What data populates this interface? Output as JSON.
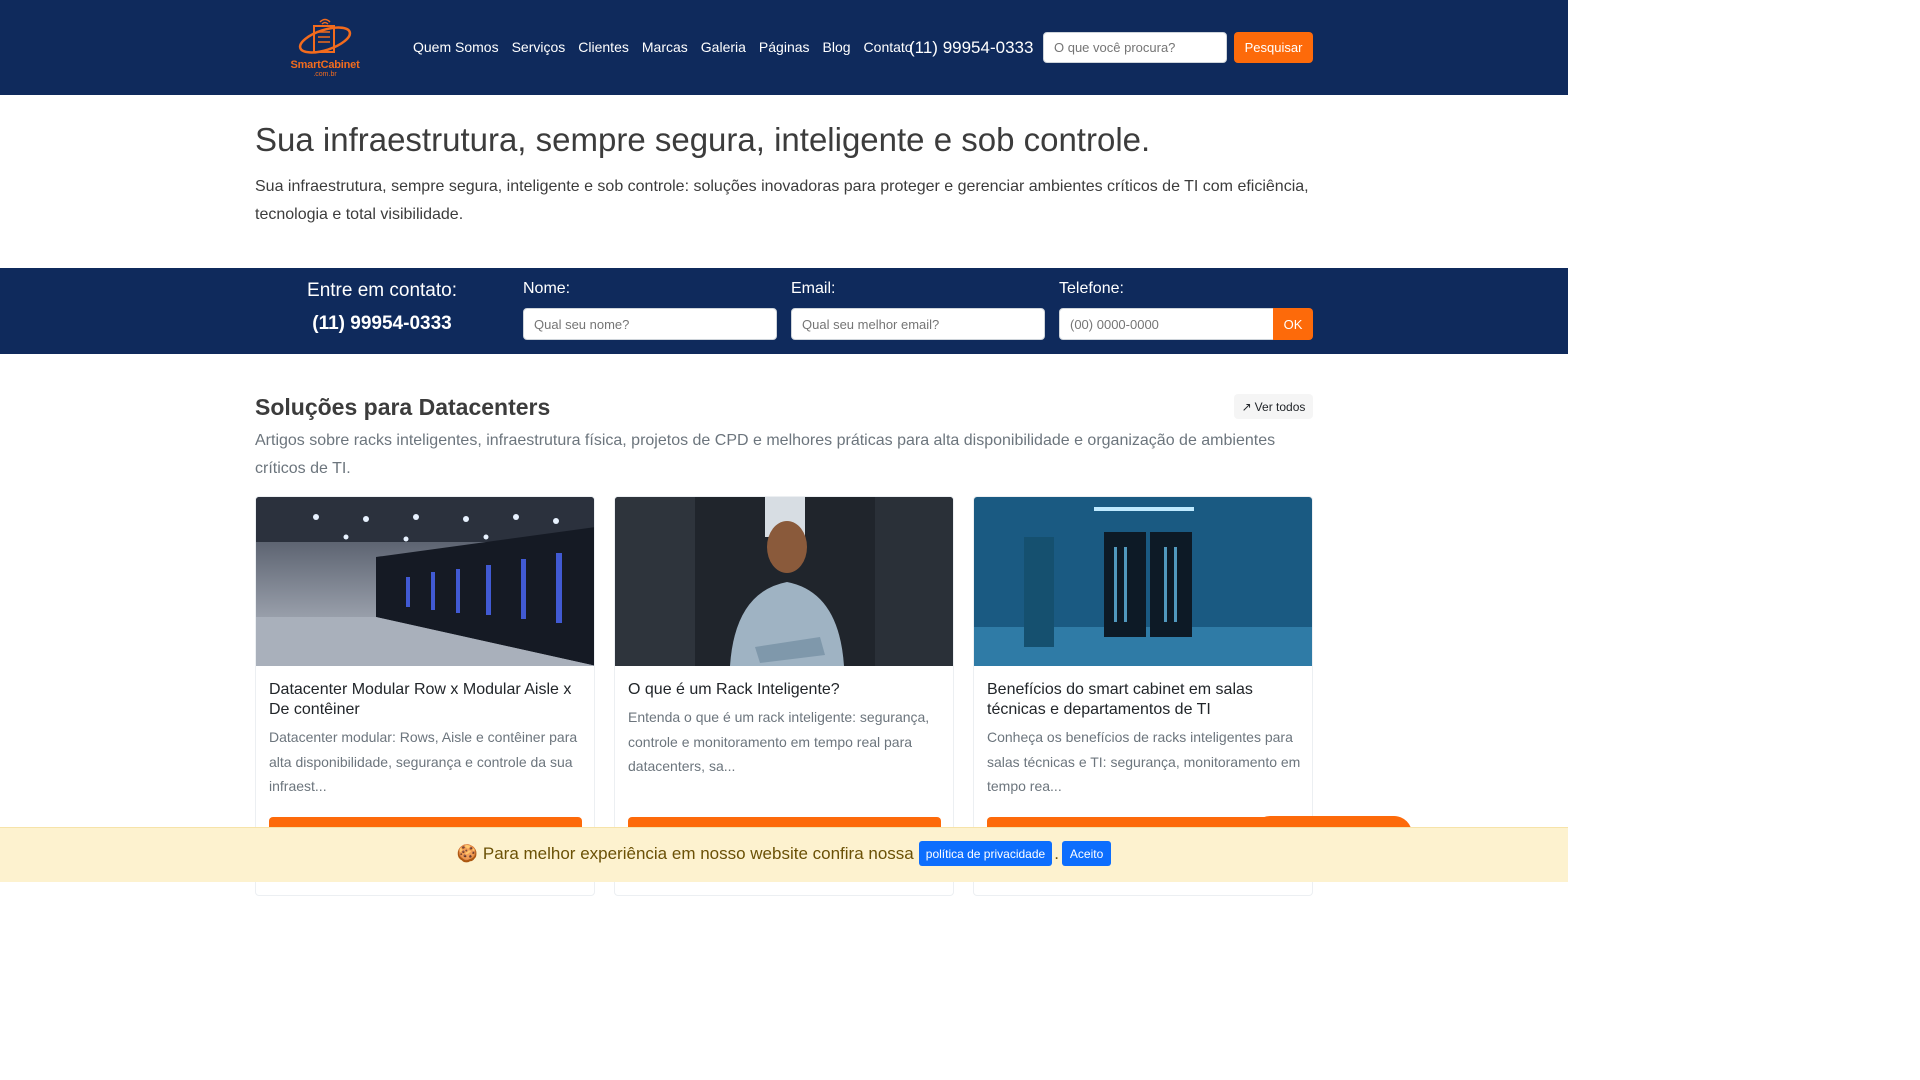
{
  "header": {
    "logo_text": "SmartCabinet",
    "logo_sub": ".com.br",
    "nav": [
      "Quem Somos",
      "Serviços",
      "Clientes",
      "Marcas",
      "Galeria",
      "Páginas",
      "Blog",
      "Contato"
    ],
    "phone": "(11) 99954-0333",
    "search_placeholder": "O que você procura?",
    "search_button": "Pesquisar"
  },
  "hero": {
    "title": "Sua infraestrutura, sempre segura, inteligente e sob controle.",
    "text": "Sua infraestrutura, sempre segura, inteligente e sob controle: soluções inovadoras para proteger e gerenciar ambientes críticos de TI com eficiência, tecnologia e total visibilidade."
  },
  "contact": {
    "label": "Entre em contato:",
    "phone": "(11) 99954-0333",
    "name_label": "Nome:",
    "name_placeholder": "Qual seu nome?",
    "email_label": "Email:",
    "email_placeholder": "Qual seu melhor email?",
    "phone_label": "Telefone:",
    "phone_placeholder": "(00) 0000-0000",
    "ok_button": "OK"
  },
  "section": {
    "title": "Soluções para Datacenters",
    "ver_todos": "Ver todos",
    "ver_todos_icon": "↗",
    "text": "Artigos sobre racks inteligentes, infraestrutura física, projetos de CPD e melhores práticas para alta disponibilidade e organização de ambientes críticos de TI."
  },
  "cards": [
    {
      "title": "Datacenter Modular Row x Modular Aisle x De contêiner",
      "text": "Datacenter modular: Rows, Aisle e contêiner para alta disponibilidade, segurança e controle da sua infraest..."
    },
    {
      "title": "O que é um Rack Inteligente?",
      "text": "Entenda o que é um rack inteligente: segurança, controle e monitoramento em tempo real para datacenters, sa..."
    },
    {
      "title": "Benefícios do smart cabinet em salas técnicas e departamentos de TI",
      "text": "Conheça os benefícios de racks inteligentes para salas técnicas e TI: segurança, monitoramento em tempo rea..."
    }
  ],
  "cookie": {
    "emoji": "🍪",
    "text": "Para melhor experiência em nosso website confira nossa",
    "policy_button": "política de privacidade",
    "dot": ".",
    "accept_button": "Aceito"
  },
  "colors": {
    "navy": "#0f2a5c",
    "orange": "#fd6a0a",
    "blue": "#0d6efd",
    "cookie_bg": "#fdf2cf"
  }
}
